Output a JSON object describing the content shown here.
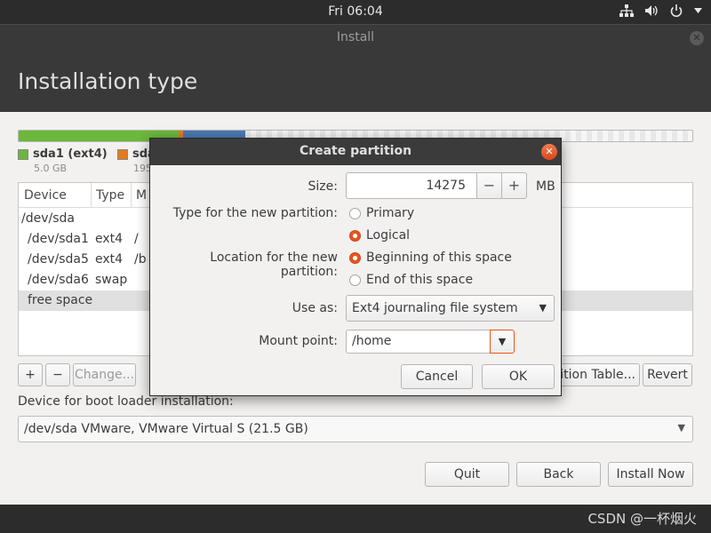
{
  "topbar": {
    "clock": "Fri 06:04"
  },
  "window": {
    "title": "Install",
    "heading": "Installation type"
  },
  "legend": [
    {
      "label": "sda1 (ext4)",
      "size": "5.0 GB",
      "color": "#6cb83a"
    },
    {
      "label": "sda",
      "size": "195",
      "color": "#e27b21"
    }
  ],
  "table": {
    "headers": [
      "Device",
      "Type",
      "M"
    ],
    "rows": [
      {
        "device": "/dev/sda",
        "type": "",
        "mount": ""
      },
      {
        "device": "/dev/sda1",
        "type": "ext4",
        "mount": "/"
      },
      {
        "device": "/dev/sda5",
        "type": "ext4",
        "mount": "/b"
      },
      {
        "device": "/dev/sda6",
        "type": "swap",
        "mount": ""
      },
      {
        "device": "free space",
        "type": "",
        "mount": ""
      }
    ]
  },
  "buttons": {
    "add": "+",
    "remove": "−",
    "change": "Change...",
    "new_table": "ition Table...",
    "revert": "Revert",
    "quit": "Quit",
    "back": "Back",
    "install": "Install Now"
  },
  "boot": {
    "label": "Device for boot loader installation:",
    "value": "/dev/sda   VMware, VMware Virtual S (21.5 GB)"
  },
  "dialog": {
    "title": "Create partition",
    "size_label": "Size:",
    "size_value": "14275",
    "minus": "−",
    "plus": "+",
    "unit": "MB",
    "type_label": "Type for the new partition:",
    "type_options": [
      "Primary",
      "Logical"
    ],
    "type_selected": "Logical",
    "location_label": "Location for the new partition:",
    "location_options": [
      "Beginning of this space",
      "End of this space"
    ],
    "location_selected": "Beginning of this space",
    "use_as_label": "Use as:",
    "use_as_value": "Ext4 journaling file system",
    "mount_label": "Mount point:",
    "mount_value": "/home",
    "cancel": "Cancel",
    "ok": "OK"
  },
  "watermark": "CSDN @一杯烟火",
  "colors": {
    "accent": "#e95420",
    "header": "#393939",
    "background": "#f2f1f0"
  }
}
